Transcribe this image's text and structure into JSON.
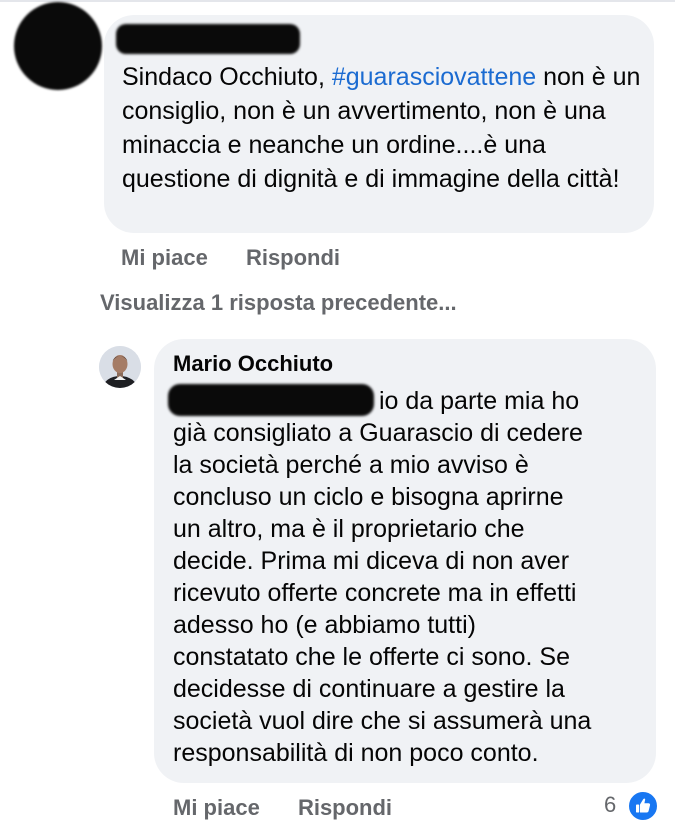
{
  "first_comment": {
    "text_prefix": "Sindaco Occhiuto,  ",
    "hashtag": "#guarasciovattene",
    "text_suffix": " non è un consiglio, non è un avvertimento, non è una minaccia e neanche un ordine....è una questione di dignità e di immagine della città!",
    "actions": {
      "like": "Mi piace",
      "reply": "Rispondi"
    }
  },
  "view_previous_replies": "Visualizza 1 risposta precedente...",
  "reply": {
    "author": "Mario Occhiuto",
    "lines": [
      "io da parte mia ho",
      "già consigliato a Guarascio di cedere",
      "la società perché a mio avviso è",
      "concluso un ciclo e bisogna aprirne",
      "un altro, ma è il proprietario che",
      "decide. Prima mi diceva di non aver",
      "ricevuto offerte concrete ma in effetti",
      "adesso ho (e abbiamo tutti)",
      "constatato che le offerte ci sono. Se",
      "decidesse di continuare a gestire la",
      "società vuol dire che si assumerà una",
      "responsabilità di non poco conto."
    ],
    "actions": {
      "like": "Mi piace",
      "reply": "Rispondi"
    },
    "reaction_count": "6",
    "reaction_icon": "like-thumb-icon",
    "accent_color": "#1877f2"
  }
}
